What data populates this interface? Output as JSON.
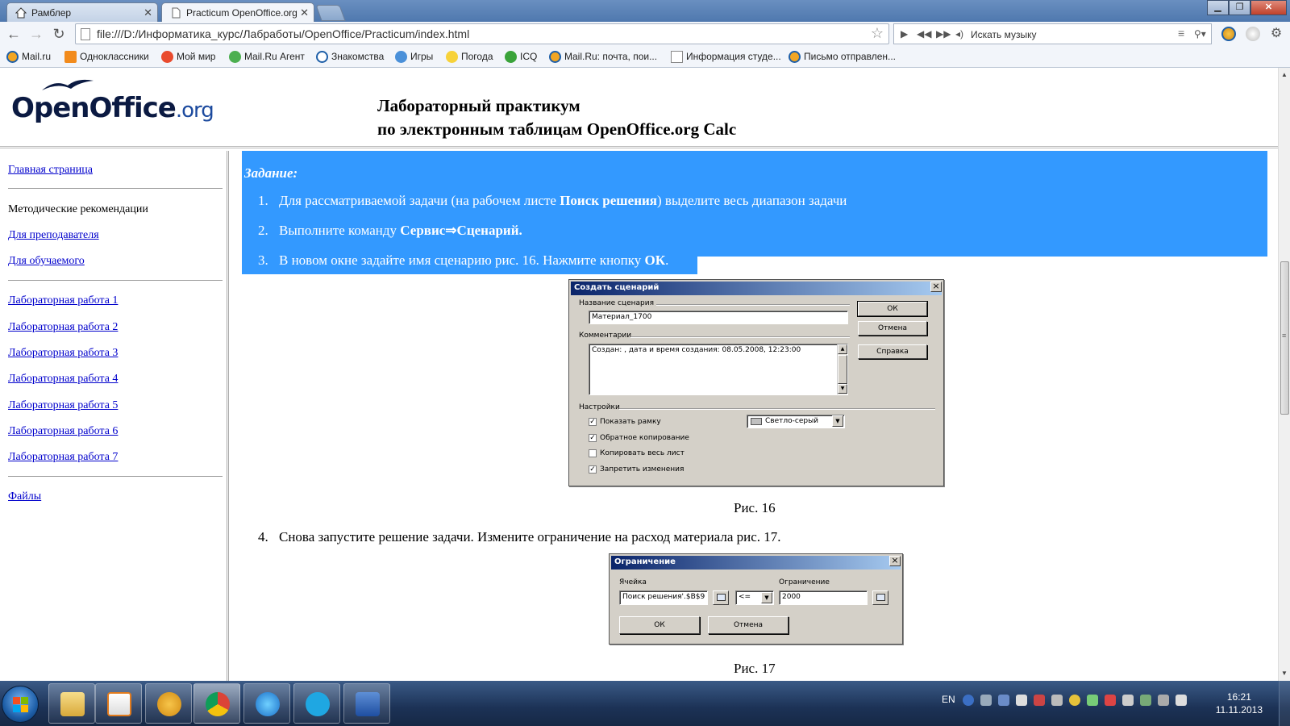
{
  "browser": {
    "tabs": [
      {
        "title": "Рамблер",
        "active": false
      },
      {
        "title": "Practicum OpenOffice.org",
        "active": true
      }
    ],
    "url": "file:///D:/Информатика_курс/Лабработы/OpenOffice/Practicum/index.html",
    "music_search_placeholder": "Искать музыку",
    "bookmarks": [
      "Mail.ru",
      "Одноклассники",
      "Мой мир",
      "Mail.Ru Агент",
      "Знакомства",
      "Игры",
      "Погода",
      "ICQ",
      "Mail.Ru: почта, пои...",
      "Информация студе...",
      "Письмо отправлен..."
    ]
  },
  "header": {
    "logo_main": "OpenOffice",
    "logo_suffix": ".org",
    "title_line1": "Лабораторный практикум",
    "title_line2": "по электронным таблицам OpenOffice.org Calc"
  },
  "sidebar": {
    "home": "Главная страница",
    "methodics_heading": "Методические рекомендации",
    "for_teacher": "Для преподавателя",
    "for_student": "Для обучаемого",
    "labs": [
      "Лабораторная работа 1",
      "Лабораторная работа 2",
      "Лабораторная работа 3",
      "Лабораторная работа 4",
      "Лабораторная работа 5",
      "Лабораторная работа 6",
      "Лабораторная работа 7"
    ],
    "files": "Файлы"
  },
  "content": {
    "task_title": "Задание:",
    "steps": [
      {
        "num": "1.",
        "pre": "Для рассматриваемой задачи (на рабочем листе ",
        "bold": "Поиск решения",
        "post": ") выделите весь диапазон задачи"
      },
      {
        "num": "2.",
        "pre": "Выполните команду ",
        "bold": "Сервис⇒Сценарий.",
        "post": ""
      },
      {
        "num": "3.",
        "pre": "В новом окне задайте имя сценарию рис. 16. Нажмите кнопку ",
        "bold": "ОК",
        "post": "."
      },
      {
        "num": "4.",
        "pre": "Снова запустите решение задачи. Измените ограничение на расход материала рис. 17.",
        "bold": "",
        "post": ""
      }
    ],
    "caption16": "Рис. 16",
    "caption17": "Рис. 17"
  },
  "dialog_scenario": {
    "title": "Создать сценарий",
    "name_label": "Название сценария",
    "name_value": "Материал_1700",
    "comments_label": "Комментарии",
    "comments_value": "Создан:  , дата и время создания: 08.05.2008, 12:23:00",
    "settings_label": "Настройки",
    "options": [
      {
        "label": "Показать рамку",
        "checked": true
      },
      {
        "label": "Обратное копирование",
        "checked": true
      },
      {
        "label": "Копировать весь лист",
        "checked": false
      },
      {
        "label": "Запретить изменения",
        "checked": true
      }
    ],
    "color_value": "Светло-серый",
    "ok": "ОК",
    "cancel": "Отмена",
    "help": "Справка"
  },
  "dialog_constraint": {
    "title": "Ограничение",
    "cell_label": "Ячейка",
    "cell_value": "Поиск решения'.$B$9",
    "operator": "<=",
    "constraint_label": "Ограничение",
    "constraint_value": "2000",
    "ok": "ОК",
    "cancel": "Отмена"
  },
  "taskbar": {
    "lang": "EN",
    "time": "16:21",
    "date": "11.11.2013"
  }
}
